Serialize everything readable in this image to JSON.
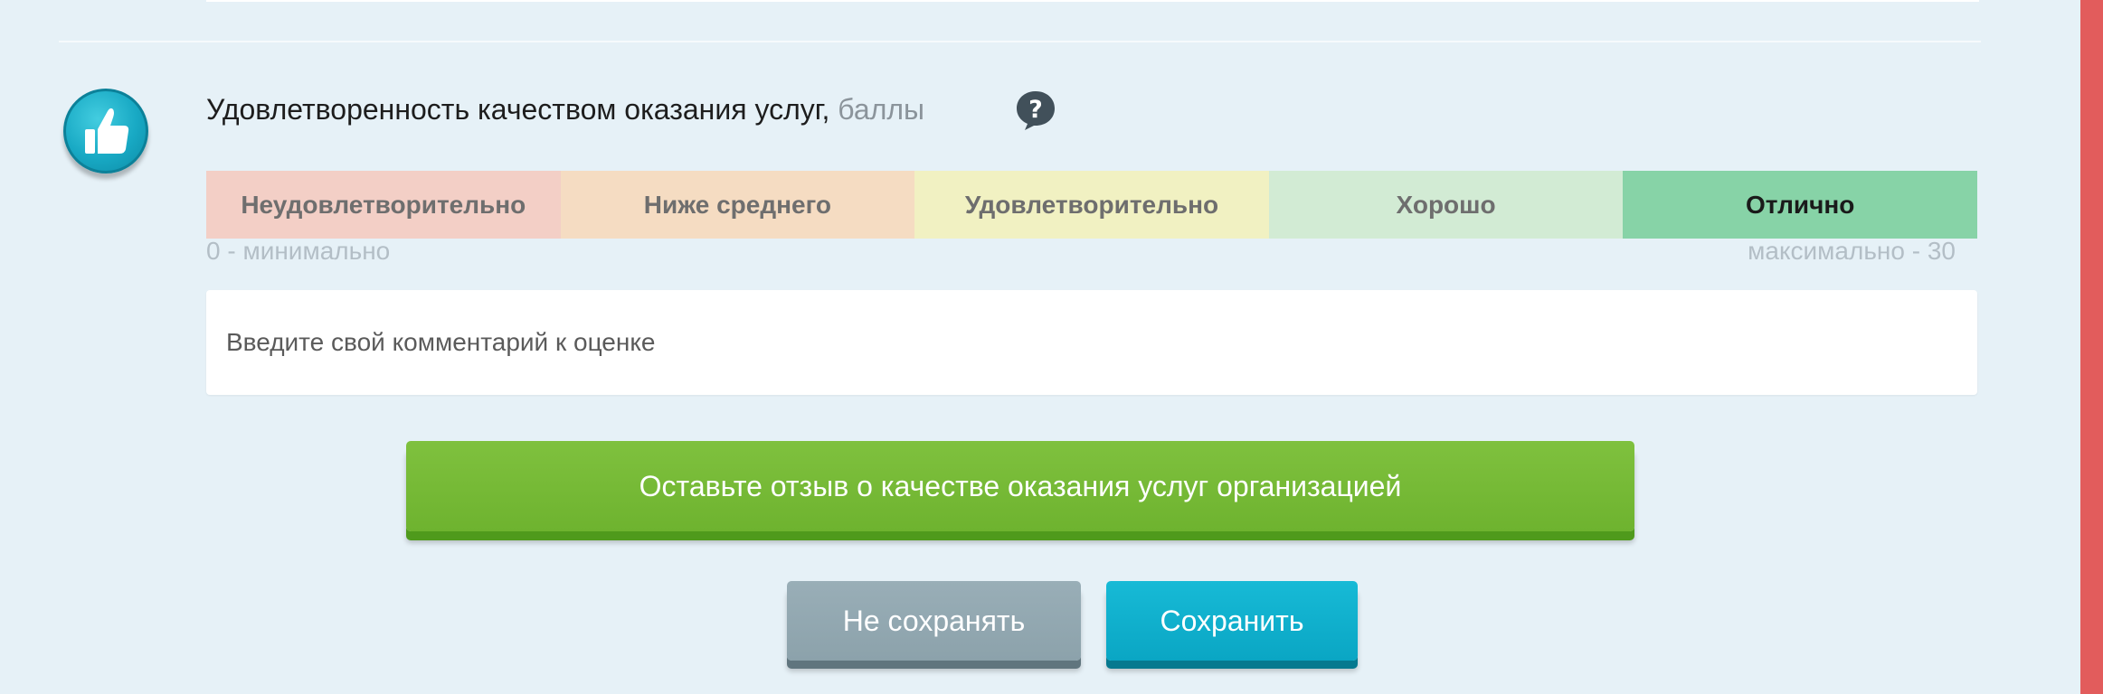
{
  "rating": {
    "title": "Удовлетворенность качеством оказания услуг,",
    "unit": "баллы",
    "help_icon": "question-bubble-icon",
    "section_icon": "thumbs-up-icon",
    "scale_min_label": "0 - минимально",
    "scale_max_label": "максимально - 30",
    "segments": [
      {
        "label": "Неудовлетворительно",
        "color": "#f3cfc6"
      },
      {
        "label": "Ниже среднего",
        "color": "#f5dcc2"
      },
      {
        "label": "Удовлетворительно",
        "color": "#f1f1c2"
      },
      {
        "label": "Хорошо",
        "color": "#d2ebd4"
      },
      {
        "label": "Отлично",
        "color": "#87d3a7"
      }
    ],
    "selected_label": "Отлично"
  },
  "comment": {
    "placeholder": "Введите свой комментарий к оценке"
  },
  "actions": {
    "feedback_label": "Оставьте отзыв о качестве оказания услуг организацией",
    "cancel_label": "Не сохранять",
    "save_label": "Сохранить"
  },
  "colors": {
    "panel_background": "#e6f1f7",
    "accent_teal": "#0aa6c4",
    "feedback_green": "#76b935",
    "cancel_gray": "#93a8b1",
    "edge_red": "#e25c5c"
  }
}
